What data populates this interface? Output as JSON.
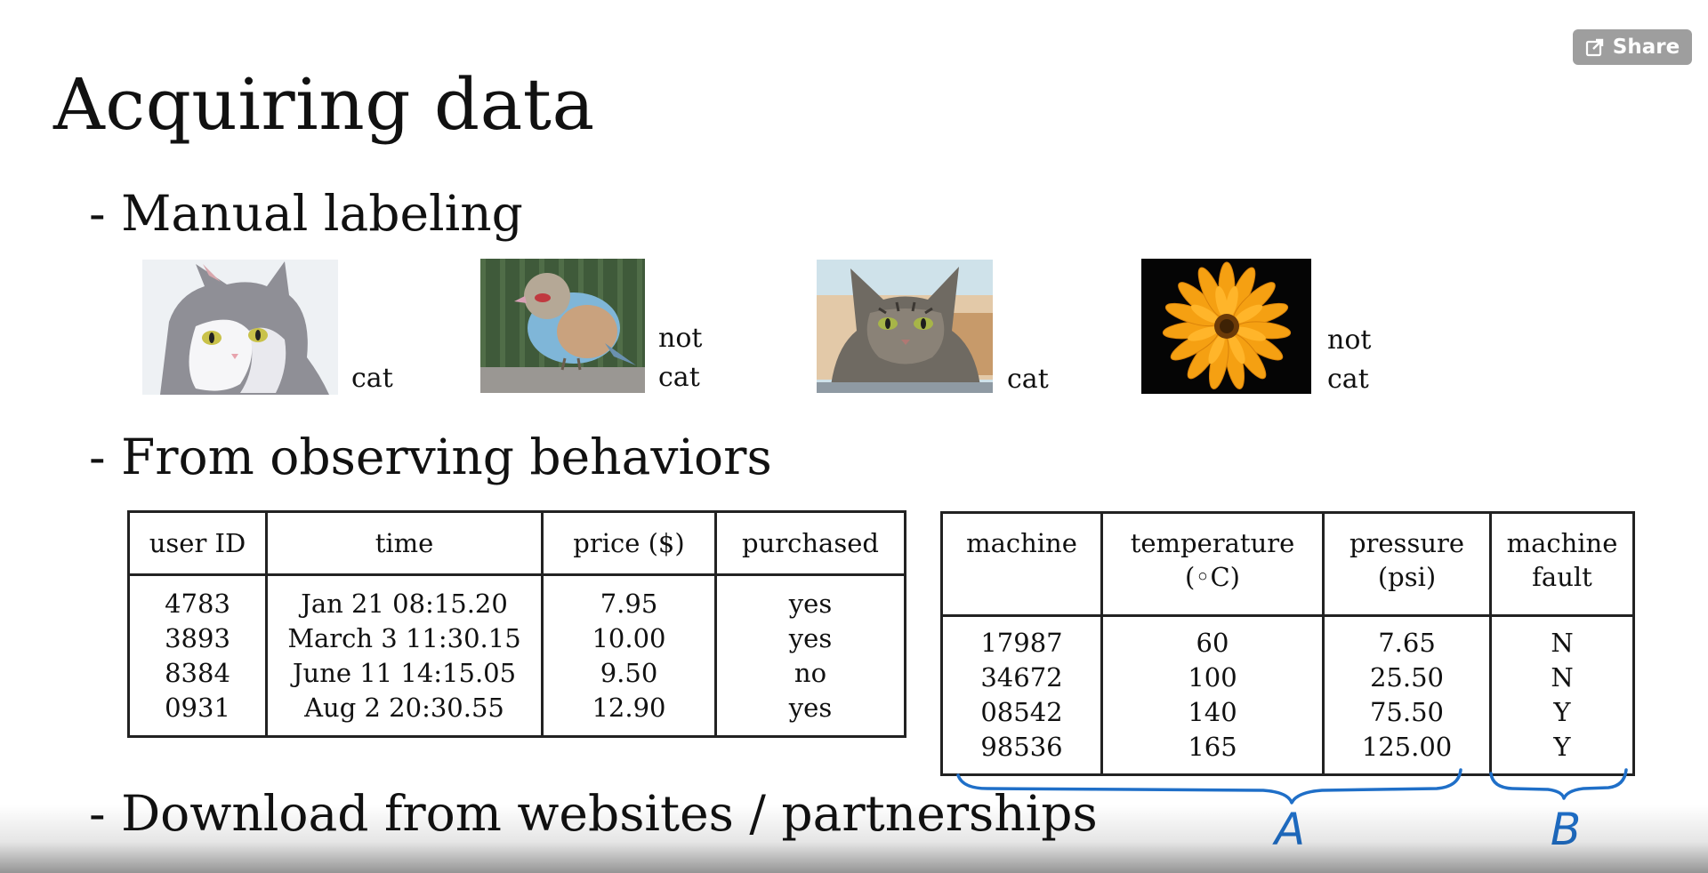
{
  "slide": {
    "title": "Acquiring data",
    "bullets": {
      "manual": "- Manual labeling",
      "observing": "- From observing behaviors",
      "download": "- Download from websites / partnerships"
    }
  },
  "share_button": {
    "label": "Share",
    "icon": "share-icon"
  },
  "images": [
    {
      "name": "white-gray-cat",
      "label": "cat"
    },
    {
      "name": "blue-bird",
      "label_line1": "not",
      "label_line2": "cat"
    },
    {
      "name": "tabby-cat",
      "label": "cat"
    },
    {
      "name": "orange-flower",
      "label_line1": "not",
      "label_line2": "cat"
    }
  ],
  "purchase_table": {
    "headers": [
      "user ID",
      "time",
      "price ($)",
      "purchased"
    ],
    "columns": [
      [
        "4783",
        "3893",
        "8384",
        "0931"
      ],
      [
        "Jan 21 08:15.20",
        "March 3 11:30.15",
        "June 11 14:15.05",
        "Aug 2 20:30.55"
      ],
      [
        "7.95",
        "10.00",
        "9.50",
        "12.90"
      ],
      [
        "yes",
        "yes",
        "no",
        "yes"
      ]
    ]
  },
  "machine_table": {
    "headers": [
      [
        "machine",
        ""
      ],
      [
        "temperature",
        "(◦C)"
      ],
      [
        "pressure",
        "(psi)"
      ],
      [
        "machine",
        "fault"
      ]
    ],
    "columns": [
      [
        "17987",
        "34672",
        "08542",
        "98536"
      ],
      [
        "60",
        "100",
        "140",
        "165"
      ],
      [
        "7.65",
        "25.50",
        "75.50",
        "125.00"
      ],
      [
        "N",
        "N",
        "Y",
        "Y"
      ]
    ]
  },
  "annotations": {
    "brace_a": "A",
    "brace_b": "B",
    "ink_color": "#1f6fc8"
  }
}
